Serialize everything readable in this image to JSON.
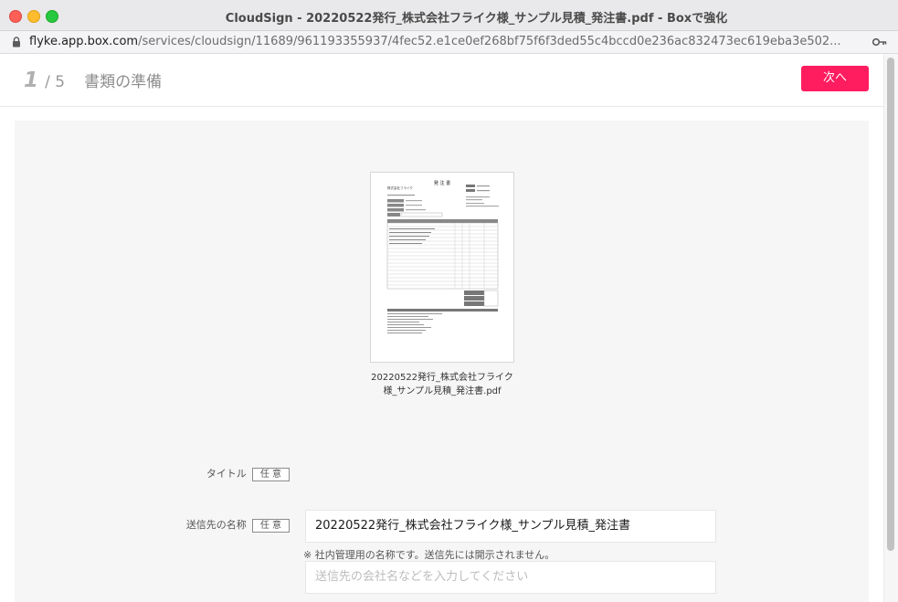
{
  "window": {
    "title": "CloudSign - 20220522発行_株式会社フライク様_サンプル見積_発注書.pdf - Boxで強化"
  },
  "urlbar": {
    "host": "flyke.app.box.com",
    "path": "/services/cloudsign/11689/961193355937/4fec52.e1ce0ef268bf75f6f3ded55c4bccd0e236ac832473ec619eba3e502..."
  },
  "header": {
    "step_current": "1",
    "step_total": "/ 5",
    "step_label": "書類の準備",
    "next_label": "次へ"
  },
  "document": {
    "name_line1": "20220522発行_株式会社フライク",
    "name_line2": "様_サンプル見積_発注書.pdf",
    "thumb_title": "発 注 書",
    "thumb_company": "株式会社フライク"
  },
  "form": {
    "title_label": "タイトル",
    "title_badge": "任 意",
    "title_value": "20220522発行_株式会社フライク様_サンプル見積_発注書",
    "recipient_label": "送信先の名称",
    "recipient_badge": "任 意",
    "recipient_placeholder": "送信先の会社名などを入力してください",
    "recipient_hint": "※ 社内管理用の名称です。送信先には開示されません。"
  },
  "colors": {
    "accent": "#ff1c5f"
  }
}
